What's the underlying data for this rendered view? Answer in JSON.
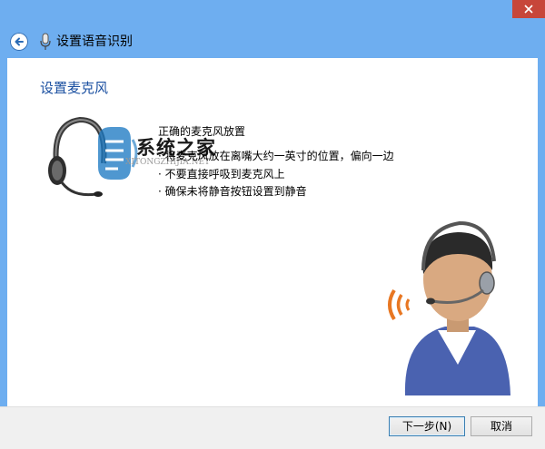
{
  "window": {
    "title": "设置语音识别"
  },
  "page": {
    "heading": "设置麦克风",
    "tips_title": "正确的麦克风放置",
    "tips": [
      "· 将麦克风放在离嘴大约一英寸的位置，偏向一边",
      "· 不要直接呼吸到麦克风上",
      "· 确保未将静音按钮设置到静音"
    ]
  },
  "watermark": {
    "text": "系统之家",
    "sub": "XITONGZHIJIA.NET"
  },
  "footer": {
    "next_label": "下一步(N)",
    "cancel_label": "取消"
  },
  "colors": {
    "frame": "#6eaef0",
    "close": "#c7463a",
    "heading": "#1a4fa0",
    "footer": "#f0f0f0"
  },
  "icons": [
    "close-icon",
    "back-arrow-icon",
    "microphone-icon",
    "headset-image",
    "speaker-avatar-image"
  ]
}
